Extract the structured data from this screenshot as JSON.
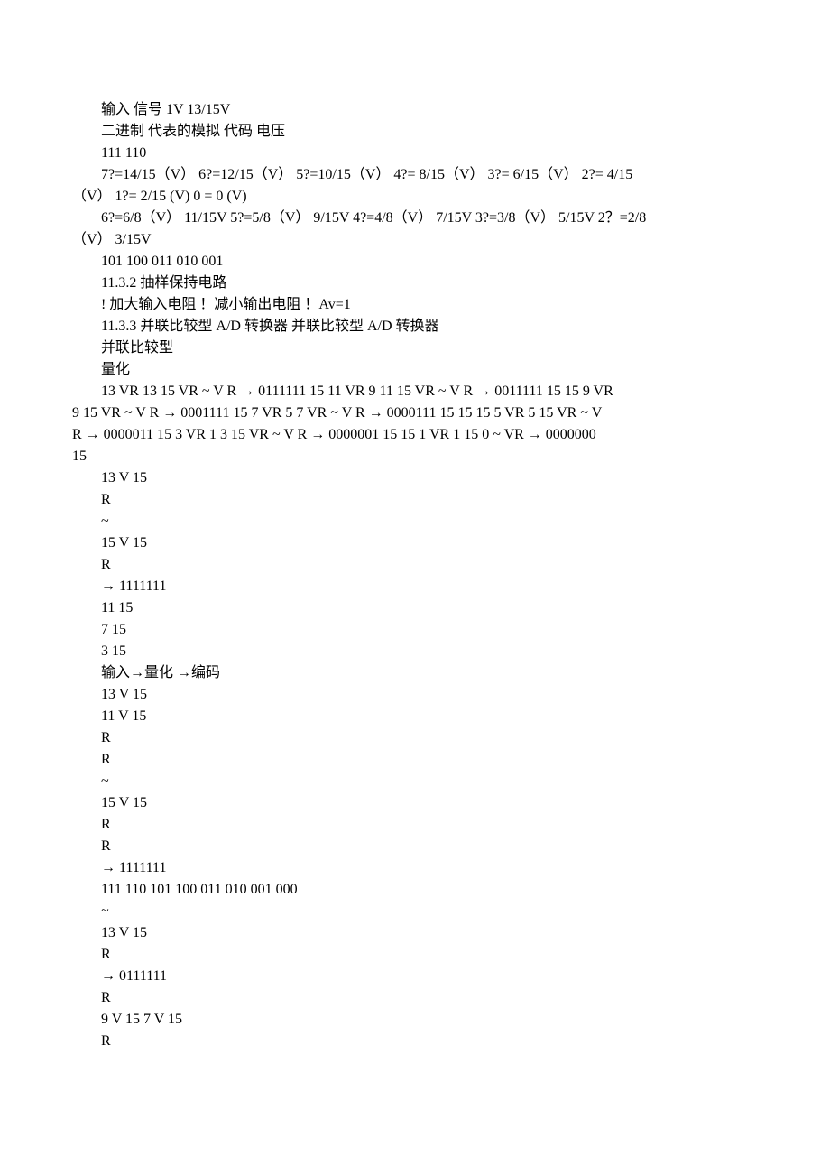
{
  "lines": [
    "输入 信号 1V 13/15V",
    "二进制 代表的模拟 代码 电压",
    "111 110",
    "7?=14/15（V）  6?=12/15（V）  5?=10/15（V）  4?= 8/15（V）  3?= 6/15（V）  2?= 4/15",
    "（V）  1?= 2/15 (V)  0 = 0 (V)",
    "6?=6/8（V）  11/15V 5?=5/8（V）  9/15V 4?=4/8（V）  7/15V 3?=3/8（V）  5/15V 2？=2/8",
    "（V）  3/15V",
    "101 100 011 010 001",
    "11.3.2 抽样保持电路",
    "! 加大输入电阻 ！减小输出电阻 ！Av=1",
    "11.3.3 并联比较型 A/D 转换器 并联比较型 A/D 转换器",
    "并联比较型",
    "量化",
    "13 VR 13 15 VR ~ V R → 0111111 15 11 VR 9 11 15 VR ~ V R → 0011111 15 15 9 VR",
    "9 15 VR ~ V R → 0001111 15 7 VR 5 7 VR ~ V R → 0000111 15 15 15 5 VR 5 15 VR ~ V",
    "R → 0000011 15 3 VR 1 3 15 VR ~ V R → 0000001 15 15 1 VR 1 15 0 ~ VR → 0000000",
    "15",
    "13 V 15",
    "R",
    "~",
    "15 V 15",
    "R",
    "→ 1111111",
    "11 15",
    "7 15",
    "3 15",
    "输入→量化 →编码",
    "13 V 15",
    "11 V 15",
    "R",
    "R",
    "~",
    "15 V 15",
    "R",
    "R",
    "→ 1111111",
    "111 110 101 100 011 010 001 000",
    "~",
    "13 V 15",
    "R",
    "→ 0111111",
    "R",
    "9 V 15 7 V 15",
    "R"
  ],
  "wrapLines": [
    3,
    5,
    13
  ]
}
